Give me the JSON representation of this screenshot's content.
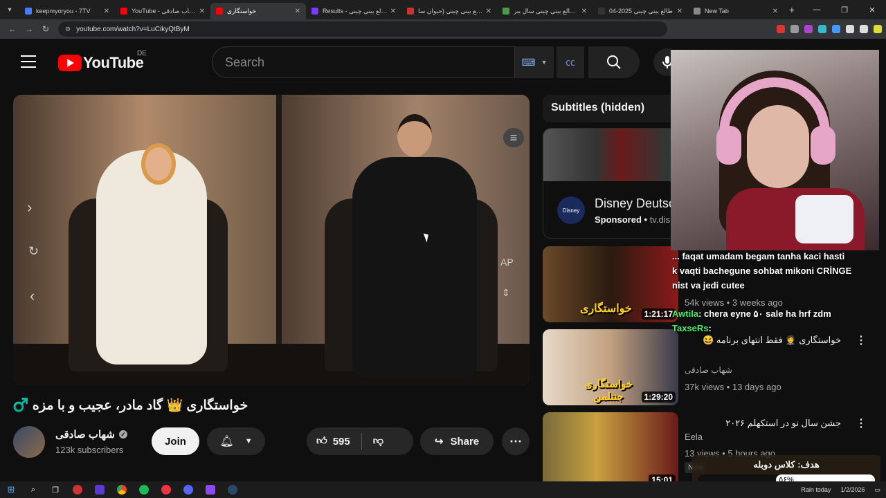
{
  "browser": {
    "tabs": [
      {
        "title": "keepmyoryou - 7TV",
        "color": "#4a7aff"
      },
      {
        "title": "YouTube - شهاب صادقی",
        "color": "#ff0000"
      },
      {
        "title": "خواستگاری",
        "color": "#ff0000",
        "active": true
      },
      {
        "title": "Results - طالع بینی چینی",
        "color": "#7a3aff"
      },
      {
        "title": "طالع بینی چینی (حیوان سا...",
        "color": "#cc3333"
      },
      {
        "title": "طالع بینی چینی سال ببر -",
        "color": "#4a9a4a"
      },
      {
        "title": "طالع بینی چینی 2025-04",
        "color": "#333333"
      },
      {
        "title": "New Tab",
        "color": "#888888"
      }
    ],
    "url": "youtube.com/watch?v=LuCikyQtByM",
    "new_tab_symbol": "+",
    "window_controls": [
      "—",
      "❐",
      "✕"
    ],
    "extension_colors": [
      "#dd3333",
      "#999999",
      "#aa44cc",
      "#33bbcc",
      "#4499ff",
      "#dddddd",
      "#dddddd",
      "#dddd33"
    ]
  },
  "header": {
    "logo_text": "YouTube",
    "country_code": "DE",
    "search_placeholder": "Search"
  },
  "video": {
    "title": "خواستگاری 👑 گاد مادر، عجیب و با مزه ♂️",
    "channel_name": "شهاب صادقی",
    "subscribers": "123k subscribers",
    "join_label": "Join",
    "like_count": "595",
    "share_label": "Share",
    "overlay_text": "AP"
  },
  "sidebar": {
    "subtitles_label": "Subtitles (hidden)",
    "ad": {
      "title": "Disney Deutsc",
      "sponsored": "Sponsored",
      "domain": "tv.dis",
      "logo_text": "Disney"
    },
    "recommendations": [
      {
        "title": "",
        "channel": "",
        "meta": "54k views • 3 weeks ago",
        "duration": "1:21:17",
        "thumb_text": "خواستگاری"
      },
      {
        "title": "خواستگاری 🤵 فقط انتهای برنامه 😆",
        "channel": "شهاب صادقی",
        "meta": "37k views • 13 days ago",
        "duration": "1:29:20",
        "thumb_text": "خواستگاری جنتلمن"
      },
      {
        "title": "جشن سال نو در استکهلم ۲۰۲۶",
        "channel": "Eela",
        "meta": "13 views • 5 hours ago",
        "duration": "15:01",
        "badge": "New"
      }
    ]
  },
  "stream": {
    "chat": [
      {
        "user": "",
        "text": "... faqat umadam begam tanha kaci hasti"
      },
      {
        "user": "",
        "text": "k vaqti bachegune sohbat mikoni CRİNGE"
      },
      {
        "user": "",
        "text": "nist va jedi cutee"
      },
      {
        "user": "Awtila",
        "text": ": chera eyne ۵۰ sale ha hrf zdm"
      },
      {
        "user": "TaxseRs",
        "text": ":"
      }
    ],
    "goal_title": "هدف: کلاس دوبله",
    "goal_percent": "۵۶%",
    "goal_fraction": 0.56
  },
  "taskbar": {
    "weather": "Rain today",
    "date": "1/2/2026"
  }
}
